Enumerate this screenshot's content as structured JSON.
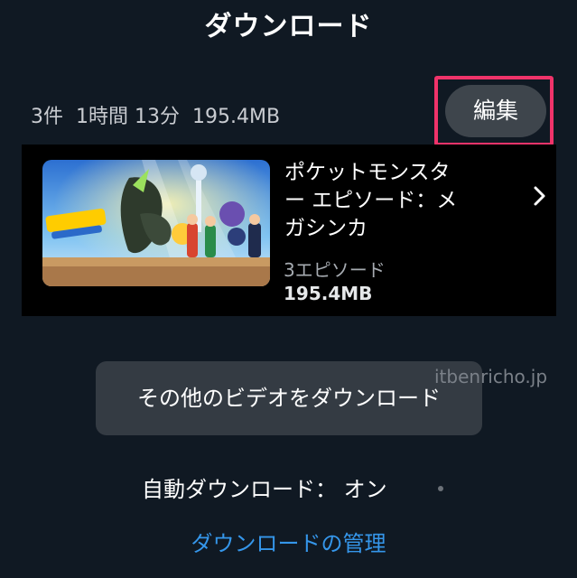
{
  "header": {
    "title": "ダウンロード"
  },
  "summary": {
    "count": "3件",
    "duration": "1時間 13分",
    "size": "195.4MB"
  },
  "edit": {
    "label": "編集",
    "highlight_color": "#f0336a"
  },
  "items": [
    {
      "title": "ポケットモンスター エピソード：メガシンカ",
      "episodes": "3エピソード",
      "size": "195.4MB",
      "thumbnail_icon": "pokemon-artwork",
      "chevron_icon": "chevron-right-icon"
    }
  ],
  "more_videos": {
    "label": "その他のビデオをダウンロード"
  },
  "watermark": "itbenricho.jp",
  "auto_download": {
    "label": "自動ダウンロード：",
    "value": "オン"
  },
  "manage_link": {
    "label": "ダウンロードの管理",
    "color": "#3596ea"
  }
}
